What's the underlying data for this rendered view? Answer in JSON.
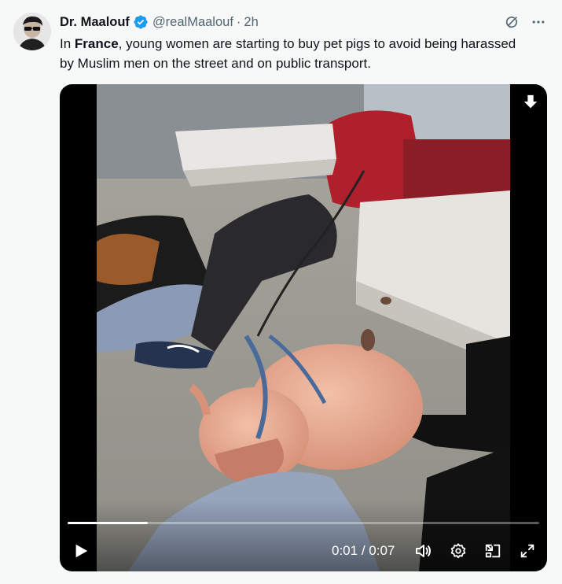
{
  "author": {
    "display_name": "Dr. Maalouf",
    "handle": "@realMaalouf",
    "separator": "·",
    "time": "2h",
    "verified": true
  },
  "tweet": {
    "text_before": "In ",
    "text_bold": "France",
    "text_after": ", young women are starting to buy pet pigs to avoid being harassed by Muslim men on the street and on public transport."
  },
  "top_actions": {
    "grok_icon": "grok-slash-circle-icon",
    "more_icon": "more-horizontal-icon"
  },
  "video": {
    "current_time": "0:01",
    "time_separator": " / ",
    "duration": "0:07",
    "progress": 0.17,
    "icons": {
      "play": "play-icon",
      "volume": "volume-icon",
      "settings": "settings-gear-icon",
      "pip": "picture-in-picture-icon",
      "fullscreen": "fullscreen-icon",
      "download": "download-icon"
    }
  },
  "colors": {
    "background": "#f7f9f9",
    "verified_blue": "#1d9bf0",
    "secondary_text": "#536471"
  }
}
